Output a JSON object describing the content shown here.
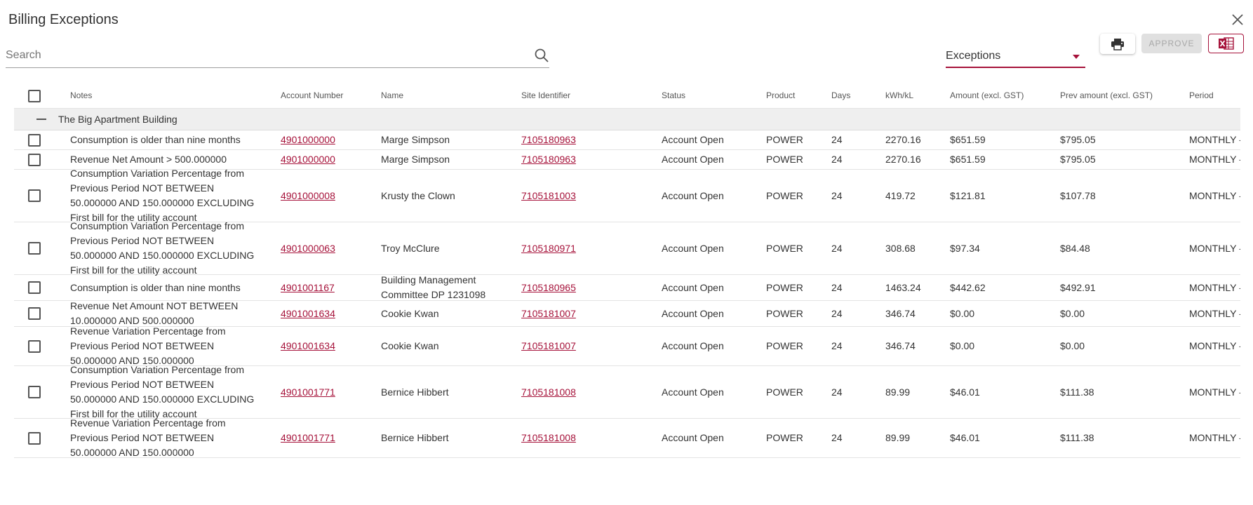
{
  "dialog": {
    "title": "Billing Exceptions"
  },
  "search": {
    "placeholder": "Search",
    "value": ""
  },
  "filter": {
    "selected": "Exceptions"
  },
  "toolbar": {
    "approve_label": "APPROVE"
  },
  "colors": {
    "accent": "#a6123a"
  },
  "icons": [
    "close-icon",
    "search-icon",
    "print-icon",
    "excel-icon"
  ],
  "table": {
    "columns": {
      "notes": "Notes",
      "account": "Account Number",
      "name": "Name",
      "site": "Site Identifier",
      "status": "Status",
      "product": "Product",
      "days": "Days",
      "kwh": "kWh/kL",
      "amount": "Amount (excl. GST)",
      "prev_amount": "Prev amount (excl. GST)",
      "period": "Period"
    },
    "group": {
      "label": "The Big Apartment Building"
    },
    "rows": [
      {
        "notes": "Consumption is older than nine months",
        "account": "4901000000",
        "name": "Marge Simpson",
        "site": "7105180963",
        "status": "Account Open",
        "product": "POWER",
        "days": "24",
        "kwh": "2270.16",
        "amount": "$651.59",
        "prev_amount": "$795.05",
        "period": "MONTHLY - "
      },
      {
        "notes": "Revenue Net Amount > 500.000000",
        "account": "4901000000",
        "name": "Marge Simpson",
        "site": "7105180963",
        "status": "Account Open",
        "product": "POWER",
        "days": "24",
        "kwh": "2270.16",
        "amount": "$651.59",
        "prev_amount": "$795.05",
        "period": "MONTHLY - "
      },
      {
        "notes": "Consumption Variation Percentage from Previous Period NOT BETWEEN 50.000000 AND 150.000000 EXCLUDING First bill for the utility account",
        "account": "4901000008",
        "name": "Krusty the Clown",
        "site": "7105181003",
        "status": "Account Open",
        "product": "POWER",
        "days": "24",
        "kwh": "419.72",
        "amount": "$121.81",
        "prev_amount": "$107.78",
        "period": "MONTHLY - "
      },
      {
        "notes": "Consumption Variation Percentage from Previous Period NOT BETWEEN 50.000000 AND 150.000000 EXCLUDING First bill for the utility account",
        "account": "4901000063",
        "name": "Troy McClure",
        "site": "7105180971",
        "status": "Account Open",
        "product": "POWER",
        "days": "24",
        "kwh": "308.68",
        "amount": "$97.34",
        "prev_amount": "$84.48",
        "period": "MONTHLY - "
      },
      {
        "notes": "Consumption is older than nine months",
        "account": "4901001167",
        "name": "Building Management Committee DP 1231098",
        "site": "7105180965",
        "status": "Account Open",
        "product": "POWER",
        "days": "24",
        "kwh": "1463.24",
        "amount": "$442.62",
        "prev_amount": "$492.91",
        "period": "MONTHLY - "
      },
      {
        "notes": "Revenue Net Amount NOT BETWEEN 10.000000 AND 500.000000",
        "account": "4901001634",
        "name": "Cookie Kwan",
        "site": "7105181007",
        "status": "Account Open",
        "product": "POWER",
        "days": "24",
        "kwh": "346.74",
        "amount": "$0.00",
        "prev_amount": "$0.00",
        "period": "MONTHLY - "
      },
      {
        "notes": "Revenue Variation Percentage from Previous Period NOT BETWEEN 50.000000 AND 150.000000",
        "account": "4901001634",
        "name": "Cookie Kwan",
        "site": "7105181007",
        "status": "Account Open",
        "product": "POWER",
        "days": "24",
        "kwh": "346.74",
        "amount": "$0.00",
        "prev_amount": "$0.00",
        "period": "MONTHLY - "
      },
      {
        "notes": "Consumption Variation Percentage from Previous Period NOT BETWEEN 50.000000 AND 150.000000 EXCLUDING First bill for the utility account",
        "account": "4901001771",
        "name": "Bernice Hibbert",
        "site": "7105181008",
        "status": "Account Open",
        "product": "POWER",
        "days": "24",
        "kwh": "89.99",
        "amount": "$46.01",
        "prev_amount": "$111.38",
        "period": "MONTHLY - "
      },
      {
        "notes": "Revenue Variation Percentage from Previous Period NOT BETWEEN 50.000000 AND 150.000000",
        "account": "4901001771",
        "name": "Bernice Hibbert",
        "site": "7105181008",
        "status": "Account Open",
        "product": "POWER",
        "days": "24",
        "kwh": "89.99",
        "amount": "$46.01",
        "prev_amount": "$111.38",
        "period": "MONTHLY - "
      }
    ]
  }
}
